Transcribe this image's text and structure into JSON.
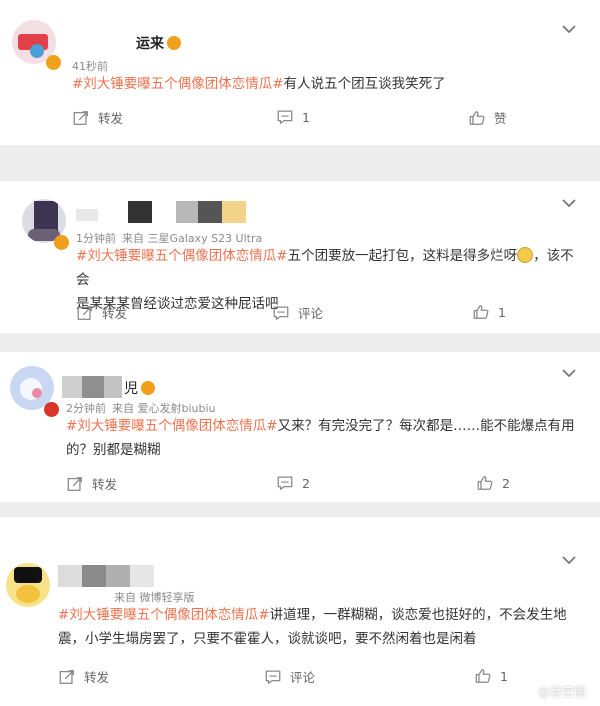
{
  "comments": [
    {
      "username": "运来",
      "meta_time": "41秒前",
      "meta_source": "",
      "topic": "#刘大锤要曝五个偶像团体恋情瓜#",
      "text": "有人说五个团互谈我笑死了",
      "text2": "",
      "actions": {
        "repost": "转发",
        "comment": "1",
        "like": "赞"
      }
    },
    {
      "username": "",
      "meta_time": "1分钟前",
      "meta_source": "来自 三星Galaxy S23 Ultra",
      "topic": "#刘大锤要曝五个偶像团体恋情瓜#",
      "text": "五个团要放一起打包，这料是得多烂呀",
      "text_after_emoji": "，该不会",
      "text2": "是某某某曾经谈过恋爱这种屁话吧",
      "actions": {
        "repost": "转发",
        "comment": "评论",
        "like": "1"
      }
    },
    {
      "username": "児",
      "meta_time": "2分钟前",
      "meta_source": "来自 爱心发射biubiu",
      "topic": "#刘大锤要曝五个偶像团体恋情瓜#",
      "text": "又来？有完没完了？每次都是……能不能爆点有用",
      "text2": "的？别都是糊糊",
      "actions": {
        "repost": "转发",
        "comment": "2",
        "like": "2"
      }
    },
    {
      "username": "",
      "meta_time": "",
      "meta_source": "来自 微博轻享版",
      "topic": "#刘大锤要曝五个偶像团体恋情瓜#",
      "text": "讲道理，一群糊糊，谈恋爱也挺好的，不会发生地",
      "text2": "震，小学生塌房罢了，只要不霍霍人，谈就谈吧，要不然闲着也是闲着",
      "actions": {
        "repost": "转发",
        "comment": "评论",
        "like": "1"
      }
    }
  ],
  "watermark": "@慧空丽",
  "colors": {
    "topic": "#eb7350",
    "meta": "#8a8a8a",
    "page_bg": "#ededed"
  }
}
